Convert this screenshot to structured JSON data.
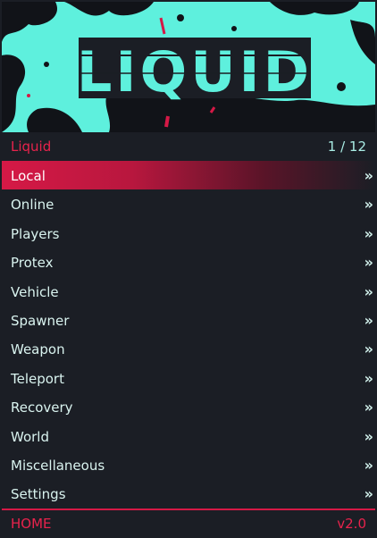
{
  "banner": {
    "title": "LIQUID"
  },
  "subheader": {
    "menu_name": "Liquid",
    "page_counter": "1 / 12"
  },
  "items": [
    {
      "label": "Local",
      "selected": true
    },
    {
      "label": "Online"
    },
    {
      "label": "Players"
    },
    {
      "label": "Protex"
    },
    {
      "label": "Vehicle"
    },
    {
      "label": "Spawner"
    },
    {
      "label": "Weapon"
    },
    {
      "label": "Teleport"
    },
    {
      "label": "Recovery"
    },
    {
      "label": "World"
    },
    {
      "label": "Miscellaneous"
    },
    {
      "label": "Settings"
    }
  ],
  "submenu_arrow": "»",
  "footer": {
    "left": "HOME",
    "right": "v2.0"
  },
  "colors": {
    "accent": "#e8234c",
    "banner_bg": "#5ef0dd",
    "menu_bg": "#1b1e25",
    "text": "#d9f3ef"
  }
}
